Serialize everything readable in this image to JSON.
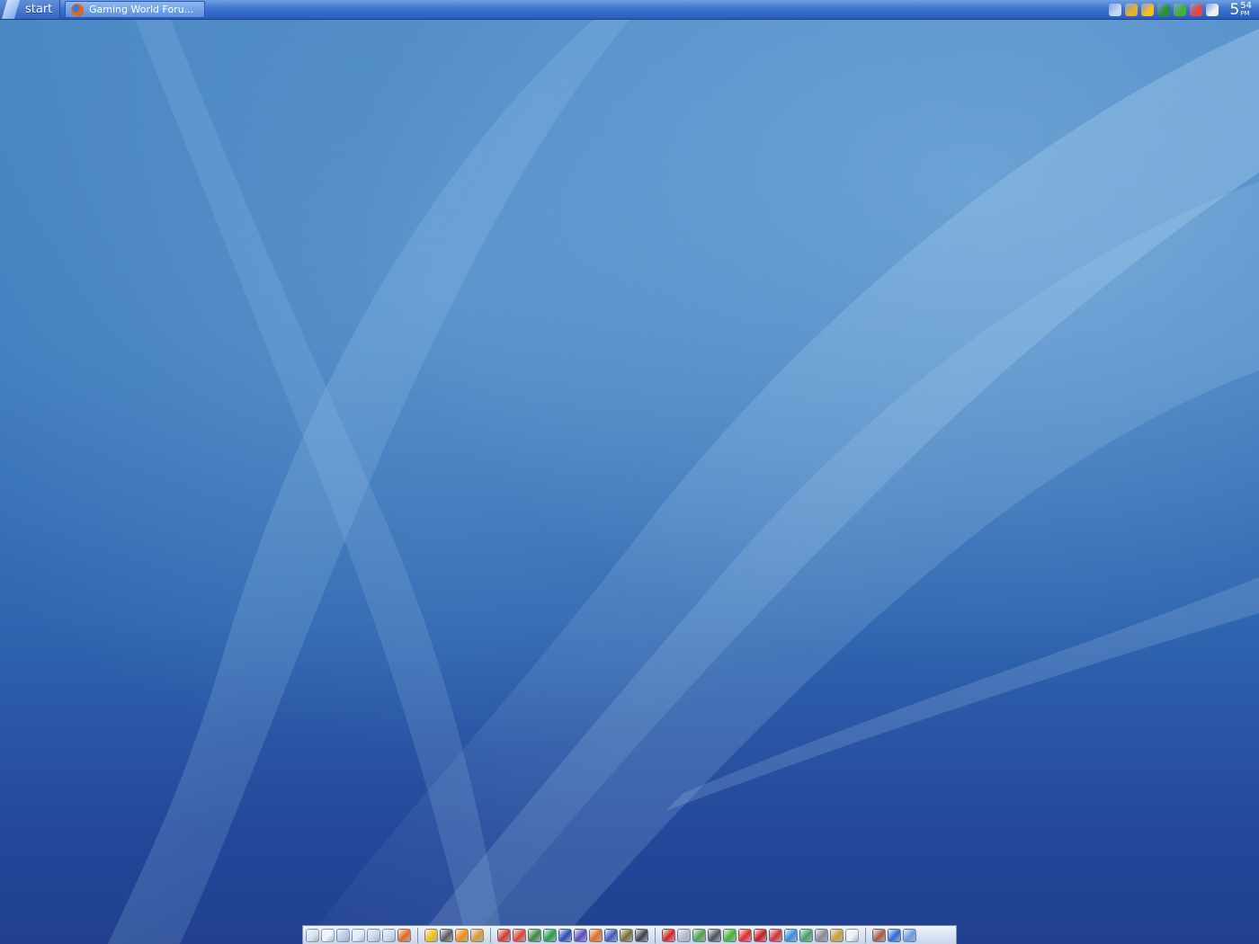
{
  "taskbar": {
    "start_label": "start",
    "open_task": {
      "label": "Gaming World Foru...",
      "icon": "firefox-icon"
    }
  },
  "tray": {
    "icons": [
      {
        "name": "tray-expand-icon",
        "color": "#c8d8f4"
      },
      {
        "name": "tray-tool-icon",
        "color": "#e8b030"
      },
      {
        "name": "tray-messenger-icon",
        "color": "#f4c020"
      },
      {
        "name": "tray-network-icon",
        "color": "#2a8f3a"
      },
      {
        "name": "tray-utorrent-icon",
        "color": "#48b030"
      },
      {
        "name": "tray-shield-icon",
        "color": "#e04848"
      },
      {
        "name": "tray-battery-icon",
        "color": "#f0f0f0"
      }
    ],
    "clock_hour": "5",
    "clock_minutes": "54",
    "clock_ampm": "PM"
  },
  "dock": {
    "groups": [
      {
        "icons": [
          {
            "name": "my-computer-icon",
            "color": "#d8e4f4"
          },
          {
            "name": "documents-icon",
            "color": "#f0f4fa"
          },
          {
            "name": "network-icon",
            "color": "#b8cce8"
          },
          {
            "name": "folder-icon",
            "color": "#e4ecf8"
          },
          {
            "name": "recycle-icon",
            "color": "#c8d8ee"
          },
          {
            "name": "display-icon",
            "color": "#d0dcf0"
          },
          {
            "name": "firefox-icon",
            "color": "#e06a1a"
          }
        ]
      },
      {
        "icons": [
          {
            "name": "messenger-icon",
            "color": "#f2c018"
          },
          {
            "name": "skull-icon",
            "color": "#5a5a5a"
          },
          {
            "name": "vlc-icon",
            "color": "#f08a10"
          },
          {
            "name": "tools-icon",
            "color": "#d89a30"
          }
        ]
      },
      {
        "icons": [
          {
            "name": "spiral-icon",
            "color": "#d03a2a"
          },
          {
            "name": "game-mario-icon",
            "color": "#e04030"
          },
          {
            "name": "game-blocks-icon",
            "color": "#3a8a3a"
          },
          {
            "name": "game-plant-icon",
            "color": "#2a9a4a"
          },
          {
            "name": "game-sega-icon",
            "color": "#2a4ab0"
          },
          {
            "name": "game-gamecube-icon",
            "color": "#5a4ab8"
          },
          {
            "name": "game-dreamcast-icon",
            "color": "#e86a1a"
          },
          {
            "name": "game-playstation-icon",
            "color": "#3a5ab8"
          },
          {
            "name": "game-sun-icon",
            "color": "#7a6a30"
          },
          {
            "name": "game-wolf-icon",
            "color": "#404040"
          }
        ]
      },
      {
        "icons": [
          {
            "name": "maple-leaf-icon",
            "color": "#d82020"
          },
          {
            "name": "notepad-icon",
            "color": "#b8b8c8"
          },
          {
            "name": "photo-icon",
            "color": "#4aa04a"
          },
          {
            "name": "phone-icon",
            "color": "#505050"
          },
          {
            "name": "utorrent-icon",
            "color": "#4ab030"
          },
          {
            "name": "record-icon",
            "color": "#e02828"
          },
          {
            "name": "acrobat-icon",
            "color": "#c81818"
          },
          {
            "name": "nero-icon",
            "color": "#d03030"
          },
          {
            "name": "globe-icon",
            "color": "#3a8ad8"
          },
          {
            "name": "drive-icon",
            "color": "#4a9a6a"
          },
          {
            "name": "pencil-icon",
            "color": "#888888"
          },
          {
            "name": "paint-icon",
            "color": "#c8a030"
          },
          {
            "name": "paper-icon",
            "color": "#f0f0f0"
          }
        ]
      },
      {
        "icons": [
          {
            "name": "archive-icon",
            "color": "#a85a3a"
          },
          {
            "name": "settings-gear-icon",
            "color": "#2a6ad0"
          },
          {
            "name": "trash-icon",
            "color": "#6a9ae0"
          }
        ]
      }
    ]
  }
}
